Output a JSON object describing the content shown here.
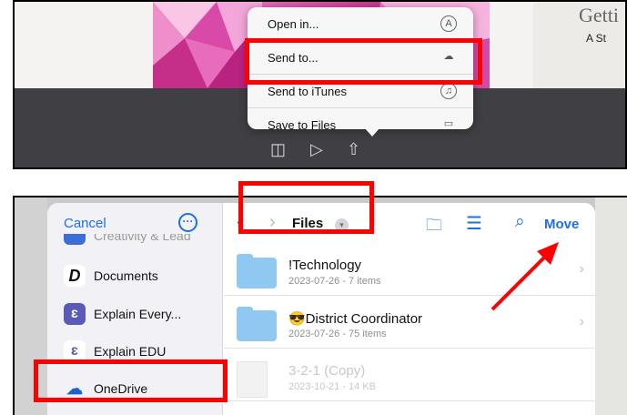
{
  "share_menu": {
    "items": [
      {
        "label": "Open in...",
        "icon": "app-store-icon"
      },
      {
        "label": "Send to...",
        "icon": "cloud-icon"
      },
      {
        "label": "Send to iTunes",
        "icon": "music-note-icon"
      },
      {
        "label": "Save to Files",
        "icon": "folder-icon"
      }
    ]
  },
  "book_cover": {
    "title": "Getti",
    "subtitle": "A St"
  },
  "file_picker": {
    "cancel_label": "Cancel",
    "title": "Files",
    "move_label": "Move",
    "sidebar_items": [
      {
        "label": "Creativity & Lead",
        "icon": "app-icon"
      },
      {
        "label": "Documents",
        "icon": "documents-d-icon"
      },
      {
        "label": "Explain Every...",
        "icon": "explain-everything-icon"
      },
      {
        "label": "Explain EDU",
        "icon": "explain-edu-icon"
      },
      {
        "label": "OneDrive",
        "icon": "onedrive-cloud-icon"
      }
    ],
    "files": [
      {
        "name": "!Technology",
        "meta": "2023-07-26 - 7 items",
        "kind": "folder"
      },
      {
        "name": "😎District Coordinator",
        "meta": "2023-07-26 - 75 items",
        "kind": "folder"
      },
      {
        "name": "3-2-1 (Copy)",
        "meta": "2023-10-21 - 14 KB",
        "kind": "file"
      }
    ]
  },
  "colors": {
    "accent": "#1f6fe5",
    "highlight": "#ff0000"
  }
}
